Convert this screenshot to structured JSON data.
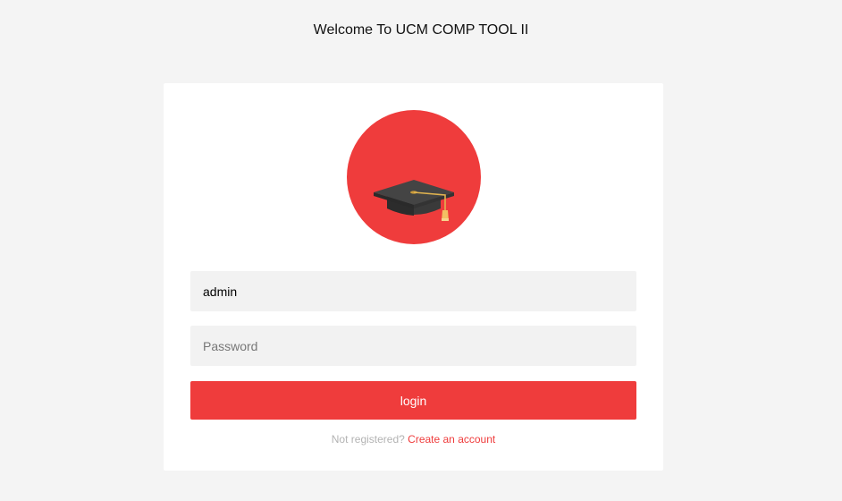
{
  "header": {
    "title": "Welcome To UCM COMP TOOL II"
  },
  "logo": {
    "icon": "graduation-cap-icon",
    "circle_color": "#ef3c3c"
  },
  "form": {
    "username_value": "admin",
    "password_placeholder": "Password",
    "login_label": "login"
  },
  "register": {
    "prompt": "Not registered?",
    "link_label": "Create an account"
  },
  "colors": {
    "accent": "#ef3c3c",
    "background": "#f4f4f4",
    "card": "#ffffff",
    "input_bg": "#f2f2f2"
  }
}
